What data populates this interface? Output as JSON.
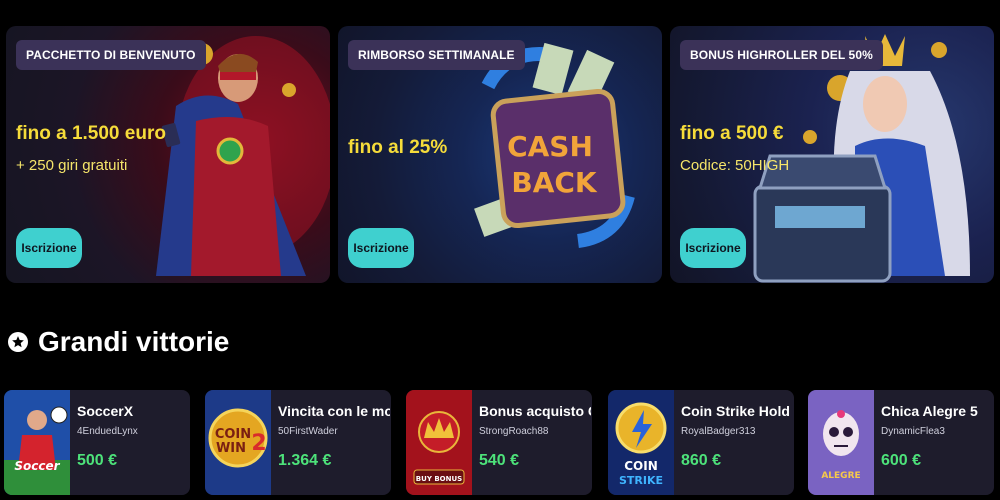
{
  "promos": [
    {
      "badge": "PACCHETTO DI BENVENUTO",
      "headline": "fino a 1.500 euro",
      "subline": "+ 250 giri gratuiti",
      "cta": "Iscrizione"
    },
    {
      "badge": "RIMBORSO SETTIMANALE",
      "headline": "fino al 25%",
      "subline": "",
      "cta": "Iscrizione",
      "art_text_1": "CASH",
      "art_text_2": "BACK"
    },
    {
      "badge": "BONUS HIGHROLLER DEL 50%",
      "headline": "fino a 500 €",
      "subline": "Codice: 50HIGH",
      "cta": "Iscrizione"
    }
  ],
  "section": {
    "title": "Grandi vittorie",
    "icon": "star-icon"
  },
  "wins": [
    {
      "game": "SoccerX",
      "user": "4EnduedLynx",
      "amount": "500 €",
      "thumb": "soccerx-thumb"
    },
    {
      "game": "Vincita con le mo...",
      "user": "50FirstWader",
      "amount": "1.364 €",
      "thumb": "coin-win-thumb"
    },
    {
      "game": "Bonus acquisto C...",
      "user": "StrongRoach88",
      "amount": "540 €",
      "thumb": "shining-crown-thumb"
    },
    {
      "game": "Coin Strike Hold a...",
      "user": "RoyalBadger313",
      "amount": "860 €",
      "thumb": "coin-strike-thumb"
    },
    {
      "game": "Chica Alegre 5",
      "user": "DynamicFlea3",
      "amount": "600 €",
      "thumb": "chica-alegre-thumb"
    }
  ],
  "colors": {
    "accent": "#3fd0cf",
    "headline": "#f6dc3a",
    "amount": "#4de27a",
    "card": "#1e1c2c",
    "badge": "#3b3258"
  }
}
